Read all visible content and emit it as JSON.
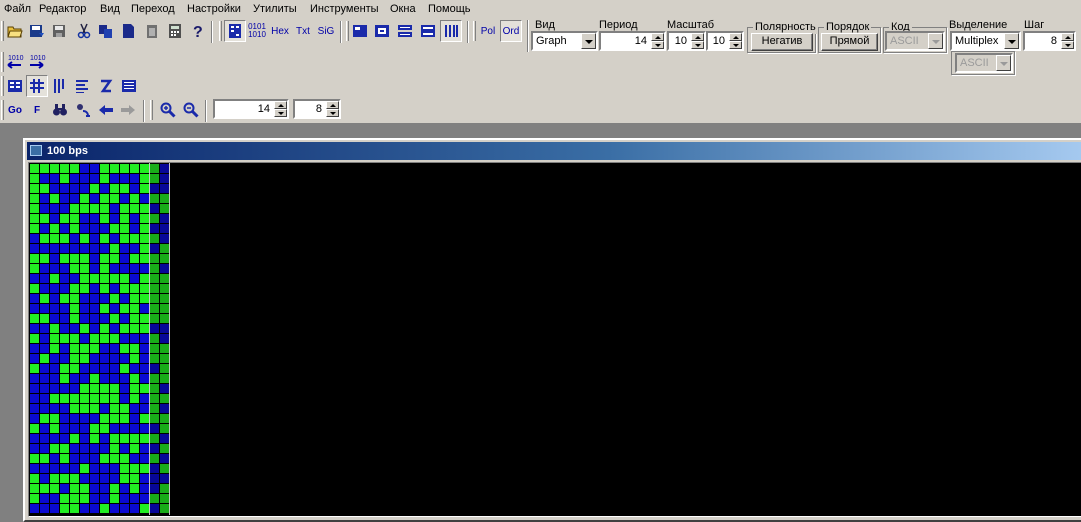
{
  "menu": [
    "Файл",
    "Редактор",
    "Вид",
    "Переход",
    "Настройки",
    "Утилиты",
    "Инструменты",
    "Окна",
    "Помощь"
  ],
  "toolbar_main": {
    "icons": [
      "open-folder-icon",
      "save-as-icon",
      "save-icon",
      "cut-icon",
      "copy-icon",
      "paste-icon",
      "clipboard-icon",
      "calculator-icon",
      "help-icon"
    ],
    "format_buttons": [
      "Hex",
      "Txt",
      "SiG"
    ],
    "bits_label_top": "0101",
    "bits_label_bottom": "1010",
    "layout_icons": [
      "layout-single-icon",
      "layout-frame-icon",
      "layout-rows-icon",
      "layout-split-icon",
      "layout-columns-icon"
    ],
    "pol_label": "Pol",
    "ord_label": "Ord"
  },
  "panel": {
    "vid": {
      "label": "Вид",
      "value": "Graph"
    },
    "period": {
      "label": "Период",
      "value": "14"
    },
    "scale": {
      "label": "Масштаб",
      "value1": "10",
      "value2": "10"
    },
    "polarity": {
      "label": "Полярность",
      "button": "Негатив"
    },
    "order": {
      "label": "Порядок",
      "button": "Прямой"
    },
    "code": {
      "label": "Код",
      "value": "ASCII"
    },
    "selection": {
      "label": "Выделение",
      "value": "Multiplex",
      "sub_value": "ASCII"
    },
    "step": {
      "label": "Шаг",
      "value": "8"
    }
  },
  "toolbar_nav": {
    "go_label": "Go",
    "f_label": "F",
    "field1_value": "14",
    "field2_value": "8"
  },
  "colors": {
    "bit_one": "#22ee22",
    "bit_zero": "#0a0ad2",
    "background": "#000000",
    "title_start": "#0a246a",
    "title_end": "#a6caf0"
  },
  "window": {
    "title": "100 bps",
    "bit_rows": [
      "11111001111110",
      "10010001000110",
      "11000010110100",
      "10100101101011",
      "10001111011101",
      "11011001010110",
      "10101000110100",
      "01110101011110",
      "00000000100101",
      "11011101101111",
      "10001101000010",
      "00100111110111",
      "10001101011111",
      "01011000101111",
      "00001001011011",
      "11001000101111",
      "00100101011100",
      "10111011100010",
      "00101110011011",
      "01001100001011",
      "10011000010001",
      "00010010001011",
      "00000111101110",
      "00111111101011",
      "00001110110010",
      "01100001110111",
      "10100011000001",
      "00001010111110",
      "00110000101001",
      "11010001110010",
      "00000100011101",
      "10111000011000",
      "11101100101001",
      "10011100100011",
      "00011001000101"
    ]
  }
}
